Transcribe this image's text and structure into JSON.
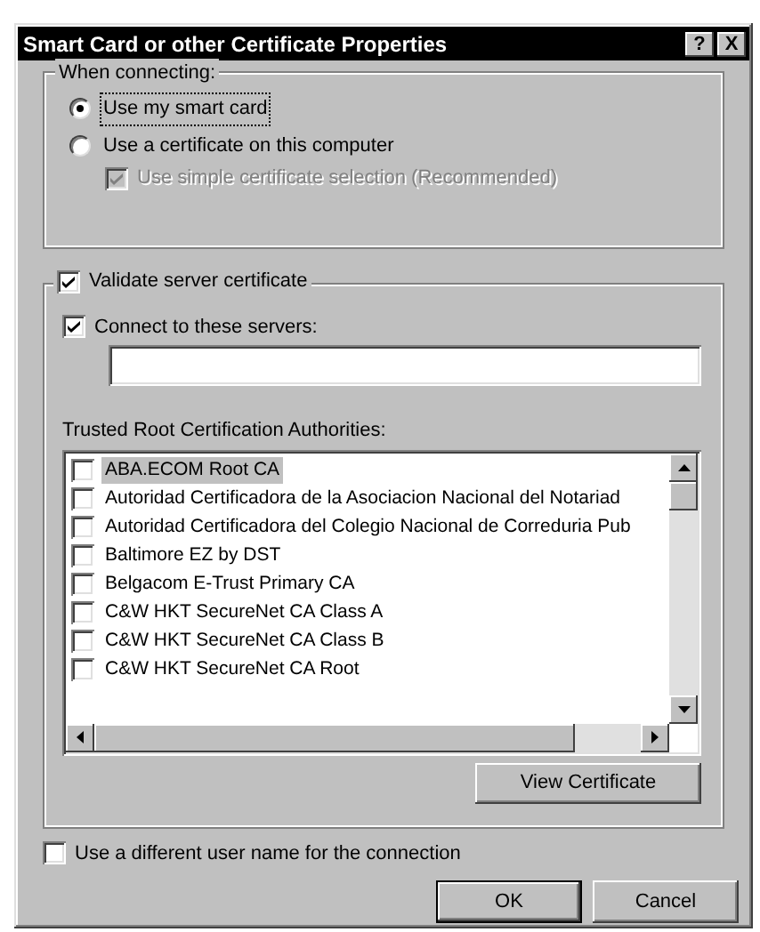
{
  "window": {
    "title": "Smart Card or other Certificate Properties",
    "title_buttons": [
      {
        "kind": "help",
        "label": "?"
      },
      {
        "kind": "close",
        "label": "X"
      }
    ]
  },
  "when_connecting": {
    "label": "When connecting:",
    "options": [
      {
        "label": "Use my smart card",
        "selected": true,
        "focused": true
      },
      {
        "label": "Use a certificate on this computer",
        "selected": false,
        "focused": false
      }
    ],
    "simple_selection": {
      "label": "Use simple certificate selection (Recommended)",
      "checked": true,
      "disabled": true
    }
  },
  "validate": {
    "label": "Validate server certificate",
    "checked": true,
    "connect": {
      "label": "Connect to these servers:",
      "checked": true
    },
    "trusted_label": "Trusted Root Certification Authorities:",
    "items": [
      {
        "label": "ABA.ECOM Root CA",
        "checked": false,
        "selected": true
      },
      {
        "label": "Autoridad Certificadora de la Asociacion Nacional del Notariad",
        "checked": false,
        "selected": false
      },
      {
        "label": "Autoridad Certificadora del Colegio Nacional de Correduria Pub",
        "checked": false,
        "selected": false
      },
      {
        "label": "Baltimore EZ by DST",
        "checked": false,
        "selected": false
      },
      {
        "label": "Belgacom E-Trust Primary CA",
        "checked": false,
        "selected": false
      },
      {
        "label": "C&W HKT SecureNet CA Class A",
        "checked": false,
        "selected": false
      },
      {
        "label": "C&W HKT SecureNet CA Class B",
        "checked": false,
        "selected": false
      },
      {
        "label": "C&W HKT SecureNet CA Root",
        "checked": false,
        "selected": false
      }
    ],
    "view_button": "View Certificate"
  },
  "different_user": {
    "label": "Use a different user name for the connection",
    "checked": false
  },
  "buttons": [
    {
      "label": "OK",
      "default": true
    },
    {
      "label": "Cancel",
      "default": false
    }
  ]
}
